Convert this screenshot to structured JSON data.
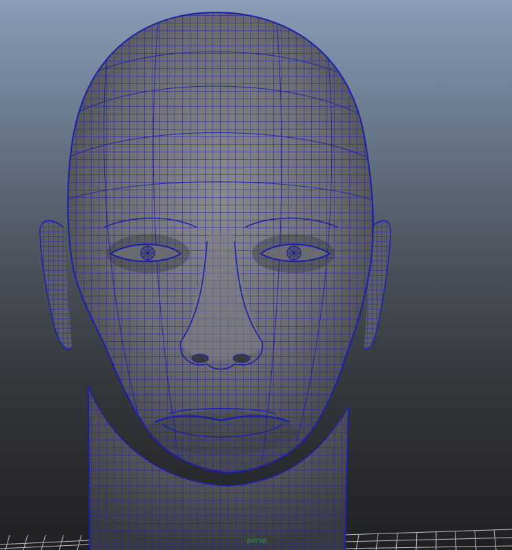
{
  "viewport": {
    "camera_name": "persp"
  },
  "icons": [
    "head-mesh-icon"
  ],
  "colors": {
    "wireframe": "#1a1fa8",
    "mesh_shading": "#6a6a70",
    "grid": "#cfd3d8",
    "camera_label": "#2f9a4e"
  }
}
